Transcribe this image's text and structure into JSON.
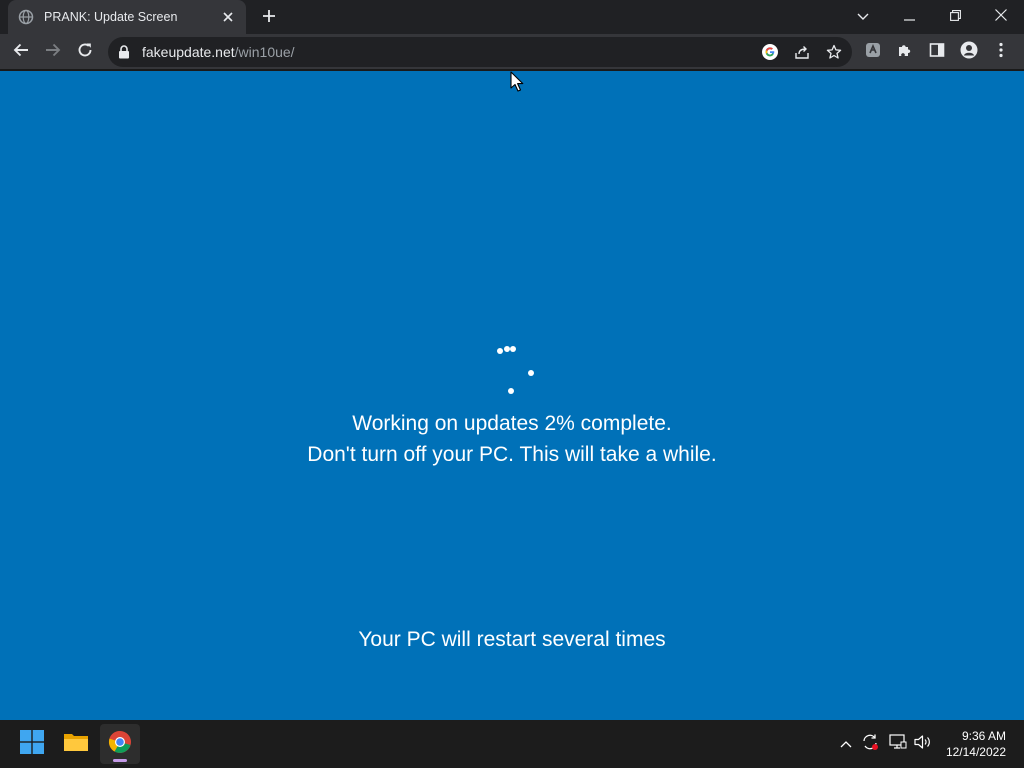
{
  "browser": {
    "tab": {
      "title": "PRANK: Update Screen",
      "favicon": "globe-icon",
      "close_icon": "close-icon"
    },
    "new_tab_icon": "plus-icon",
    "window_controls": [
      "chevron-down-icon",
      "minimize-icon",
      "restore-icon",
      "close-icon"
    ],
    "toolbar": {
      "back_icon": "arrow-left-icon",
      "forward_icon": "arrow-right-icon",
      "reload_icon": "reload-icon",
      "url_host": "fakeupdate.net",
      "url_path": "/win10ue/",
      "omnibox_icons": [
        "google-icon",
        "share-icon",
        "star-icon"
      ],
      "extension_icons": [
        "extension-shield-icon",
        "puzzle-icon",
        "side-panel-icon",
        "profile-icon",
        "kebab-menu-icon"
      ]
    }
  },
  "update_screen": {
    "progress_percent": 2,
    "line1": "Working on updates  2% complete.",
    "line2": "Don't turn off your PC. This will take a while.",
    "line3": "Your PC will restart several times",
    "background_color": "#0071b8"
  },
  "taskbar": {
    "apps": [
      "windows-start-icon",
      "file-explorer-icon",
      "chrome-icon"
    ],
    "active_app": "chrome-icon",
    "tray_icons": [
      "chevron-up-icon",
      "sync-icon",
      "network-icon",
      "volume-icon"
    ],
    "time": "9:36 AM",
    "date": "12/14/2022"
  }
}
